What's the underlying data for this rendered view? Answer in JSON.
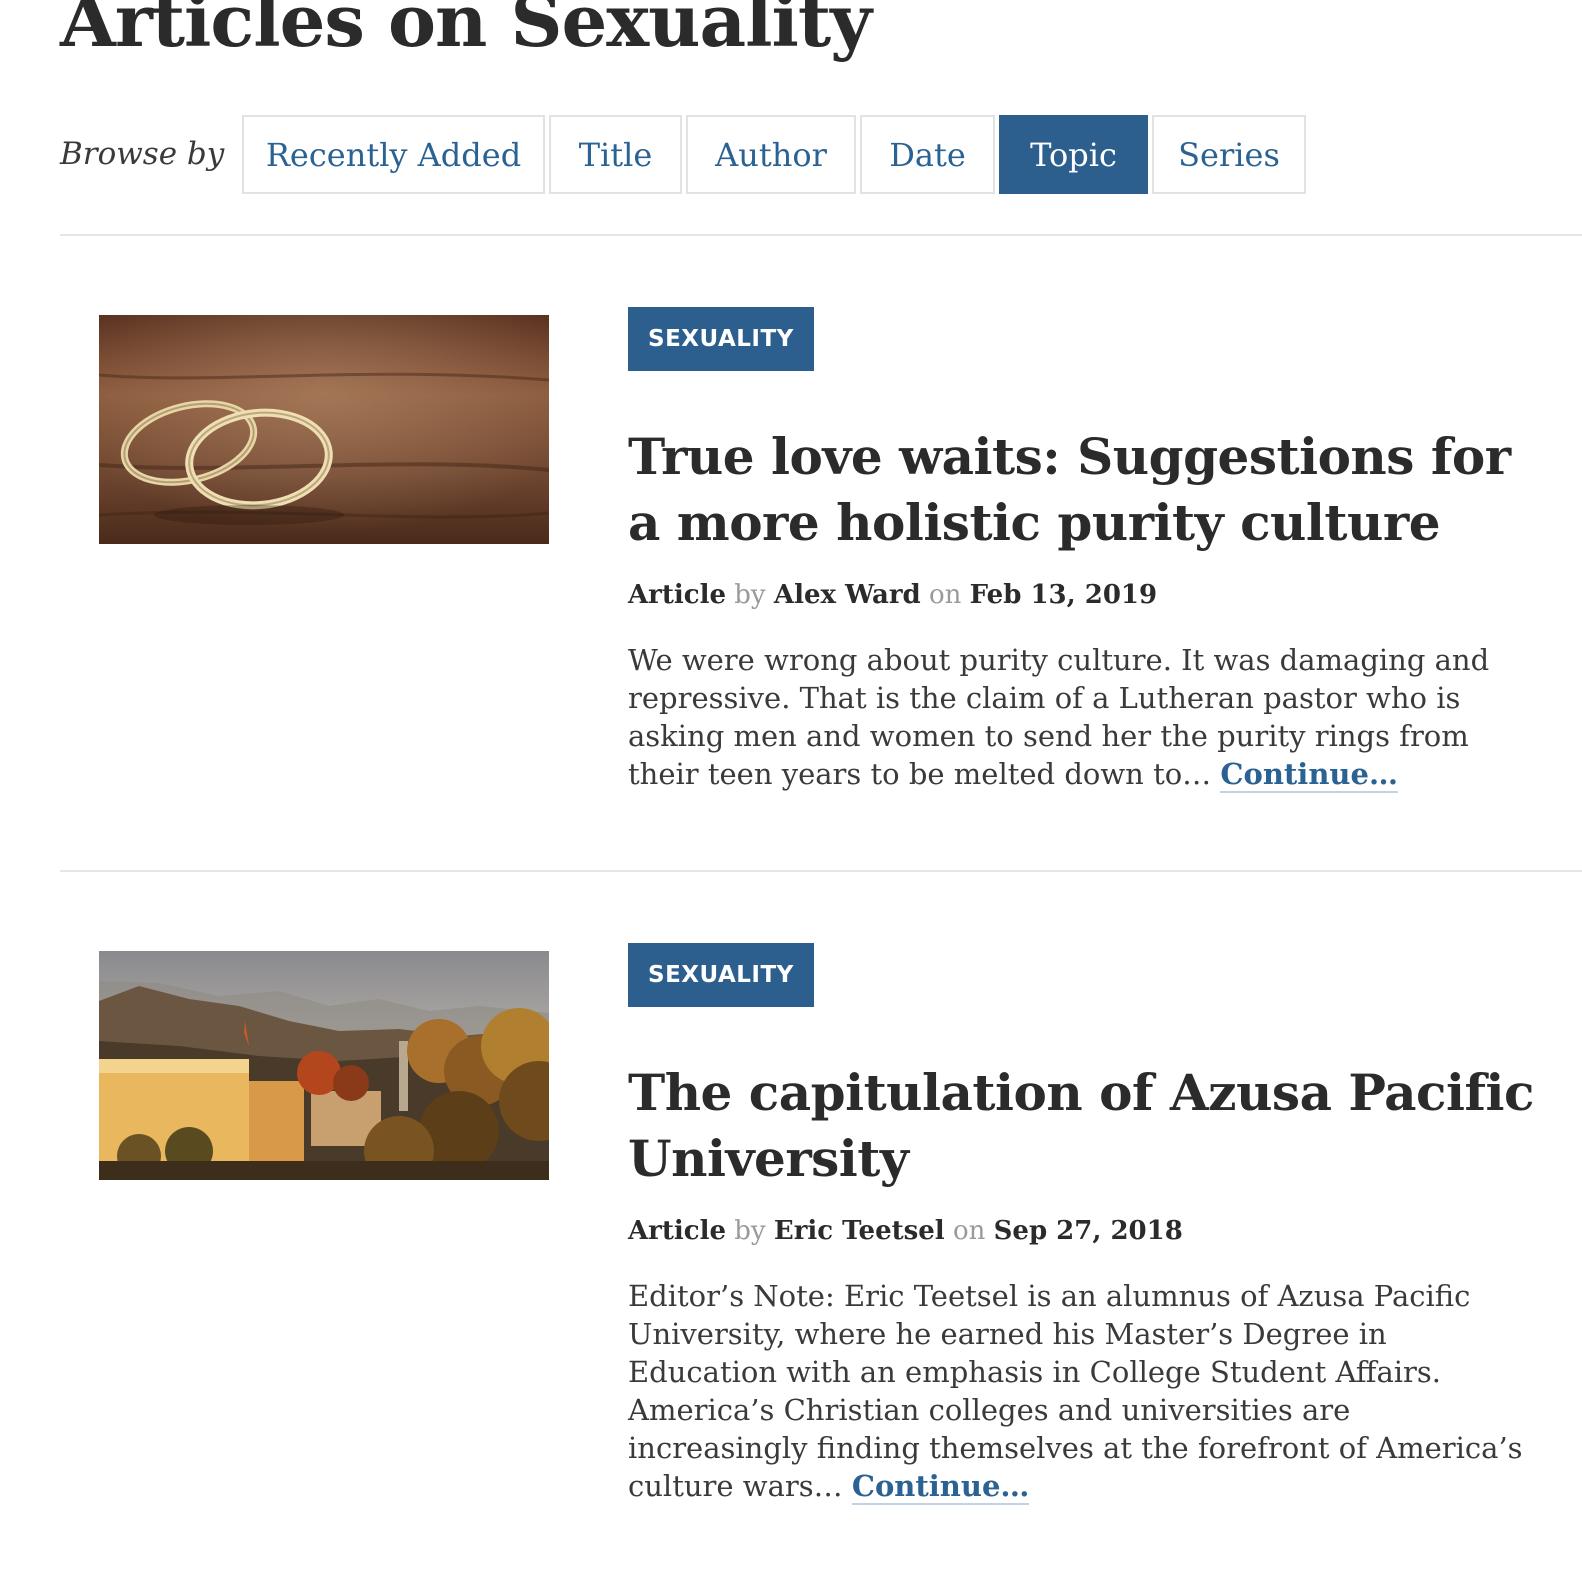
{
  "page": {
    "title": "Articles on Sexuality"
  },
  "browse": {
    "label": "Browse by",
    "tabs": [
      {
        "label": "Recently Added",
        "active": false
      },
      {
        "label": "Title",
        "active": false
      },
      {
        "label": "Author",
        "active": false
      },
      {
        "label": "Date",
        "active": false
      },
      {
        "label": "Topic",
        "active": true
      },
      {
        "label": "Series",
        "active": false
      }
    ]
  },
  "articles": [
    {
      "badge": "SEXUALITY",
      "title": "True love waits: Suggestions for a more holistic purity culture",
      "type": "Article",
      "by": "by",
      "author": "Alex Ward",
      "on": "on",
      "date": "Feb 13, 2019",
      "excerpt": "We were wrong about purity culture. It was damaging and repressive. That is the claim of a Lutheran pastor who is asking men and women to send her the purity rings from their teen years to be melted down to…",
      "continue": "Continue…",
      "image": "wedding-rings-photo"
    },
    {
      "badge": "SEXUALITY",
      "title": "The capitulation of Azusa Pacific University",
      "type": "Article",
      "by": "by",
      "author": "Eric Teetsel",
      "on": "on",
      "date": "Sep 27, 2018",
      "excerpt": "Editor’s Note: Eric Teetsel is an alumnus of Azusa Pacific University, where he earned his Master’s Degree in Education with an emphasis in College Student Affairs. America’s Christian colleges and universities are increasingly finding themselves at the forefront of America’s culture wars…",
      "continue": "Continue…",
      "image": "campus-photo"
    }
  ],
  "colors": {
    "accent": "#2c5f8e",
    "link": "#2a6293",
    "text": "#2b2b2b",
    "muted": "#9a9a9a",
    "divider": "#e6e6e6"
  }
}
